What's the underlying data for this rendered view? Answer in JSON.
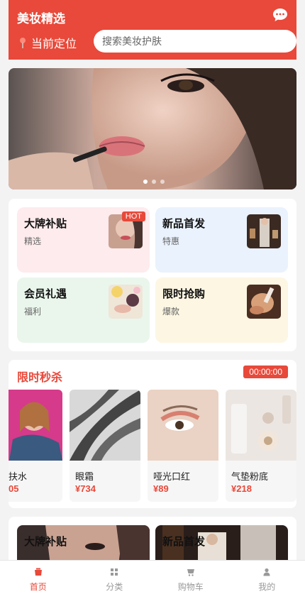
{
  "header": {
    "title": "美妆精选",
    "location_label": "当前定位",
    "search_placeholder": "搜索美妆护肤",
    "chat_icon": "chat-icon",
    "accent_color": "#e8493a"
  },
  "banner": {
    "slide_count": 3,
    "active_index": 0
  },
  "categories": [
    {
      "name": "大牌补贴",
      "sub": "精选",
      "badge": "HOT",
      "bg": "#fdebed"
    },
    {
      "name": "新品首发",
      "sub": "特惠",
      "badge": "",
      "bg": "#eaf2fd"
    },
    {
      "name": "会员礼遇",
      "sub": "福利",
      "badge": "",
      "bg": "#eaf6ec"
    },
    {
      "name": "限时抢购",
      "sub": "爆款",
      "badge": "",
      "bg": "#fdf6e3"
    }
  ],
  "flash_sale": {
    "title": "限时秒杀",
    "timer": "00:00:00",
    "products": [
      {
        "name": "扶水",
        "price": "05"
      },
      {
        "name": "眼霜",
        "price": "¥734"
      },
      {
        "name": "哑光口红",
        "price": "¥89"
      },
      {
        "name": "气垫粉底",
        "price": "¥218"
      }
    ]
  },
  "brand_strip": [
    {
      "title": "大牌补贴"
    },
    {
      "title": "新品首发"
    }
  ],
  "nav": [
    {
      "label": "首页",
      "icon": "home-icon",
      "active": true
    },
    {
      "label": "分类",
      "icon": "grid-icon",
      "active": false
    },
    {
      "label": "购物车",
      "icon": "cart-icon",
      "active": false
    },
    {
      "label": "我的",
      "icon": "user-icon",
      "active": false
    }
  ]
}
